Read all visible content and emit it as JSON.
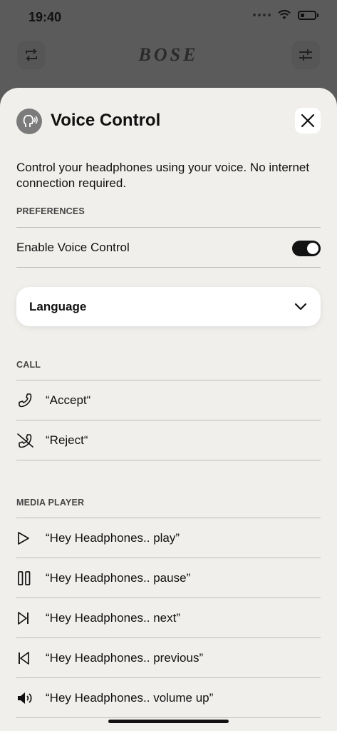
{
  "status_bar": {
    "time": "19:40"
  },
  "app_header": {
    "brand": "BOSE"
  },
  "sheet": {
    "title": "Voice Control",
    "description": "Control your headphones using your voice. No internet connection required.",
    "preferences_label": "PREFERENCES",
    "enable_label": "Enable Voice Control",
    "enable_on": true,
    "language_label": "Language",
    "call_label": "CALL",
    "call_commands": [
      {
        "icon": "phone-icon",
        "text": "“Accept“"
      },
      {
        "icon": "phone-off-icon",
        "text": "“Reject“"
      }
    ],
    "media_label": "MEDIA PLAYER",
    "media_commands": [
      {
        "icon": "play-icon",
        "text": "“Hey Headphones.. play”"
      },
      {
        "icon": "pause-icon",
        "text": "“Hey Headphones.. pause”"
      },
      {
        "icon": "next-icon",
        "text": "“Hey Headphones.. next”"
      },
      {
        "icon": "previous-icon",
        "text": "“Hey Headphones.. previous”"
      },
      {
        "icon": "volume-up-icon",
        "text": "“Hey Headphones.. volume up”"
      }
    ]
  },
  "colors": {
    "toggle_on": "#121212",
    "sheet_bg": "#f0efec",
    "overlay": "#5b5b5b"
  }
}
